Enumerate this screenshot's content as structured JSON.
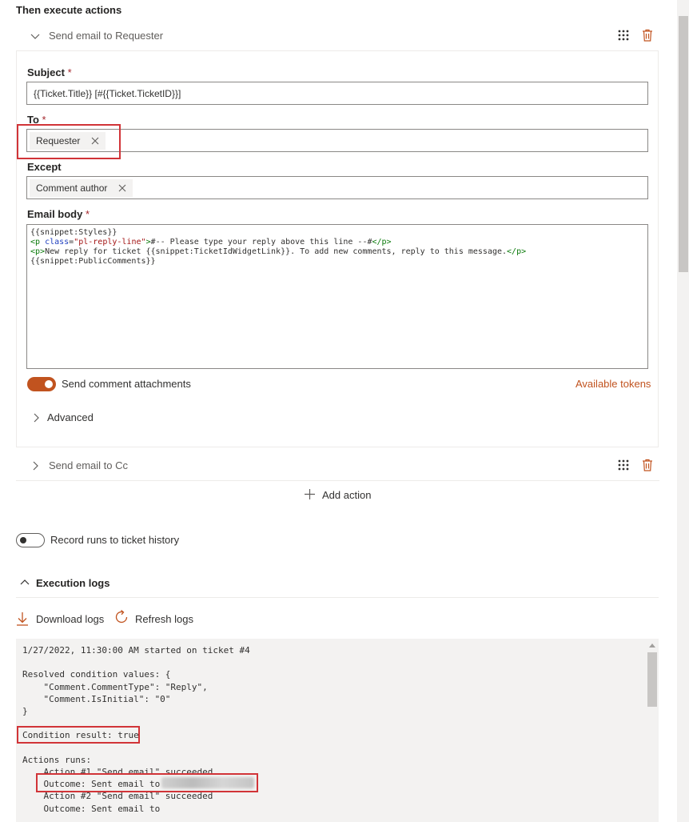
{
  "section_title": "Then execute actions",
  "actions": [
    {
      "label": "Send email to Requester",
      "expanded": true
    },
    {
      "label": "Send email to Cc",
      "expanded": false
    }
  ],
  "form": {
    "subject_label": "Subject",
    "subject_value": "{{Ticket.Title}} [#{{Ticket.TicketID}}]",
    "to_label": "To",
    "to_chip": "Requester",
    "except_label": "Except",
    "except_chip": "Comment author",
    "body_label": "Email body",
    "required_mark": "*",
    "body_lines": [
      {
        "parts": [
          {
            "t": "text",
            "v": "{{snippet:Styles}}"
          }
        ]
      },
      {
        "parts": [
          {
            "t": "tag",
            "v": "<p "
          },
          {
            "t": "aname",
            "v": "class"
          },
          {
            "t": "text",
            "v": "="
          },
          {
            "t": "attr",
            "v": "\"pl-reply-line\""
          },
          {
            "t": "tag",
            "v": ">"
          },
          {
            "t": "text",
            "v": "#-- Please type your reply above this line --#"
          },
          {
            "t": "tag",
            "v": "</p>"
          }
        ]
      },
      {
        "parts": [
          {
            "t": "tag",
            "v": "<p>"
          },
          {
            "t": "text",
            "v": "New reply for ticket {{snippet:TicketIdWidgetLink}}. To add new comments, reply to this message."
          },
          {
            "t": "tag",
            "v": "</p>"
          }
        ]
      },
      {
        "parts": [
          {
            "t": "text",
            "v": "{{snippet:PublicComments}}"
          }
        ]
      }
    ],
    "attachments_toggle_label": "Send comment attachments",
    "attachments_toggle_on": true,
    "available_tokens": "Available tokens",
    "advanced_label": "Advanced"
  },
  "add_action": "Add action",
  "record_runs_label": "Record runs to ticket history",
  "record_runs_on": false,
  "logs": {
    "title": "Execution logs",
    "download": "Download logs",
    "refresh": "Refresh logs",
    "lines": [
      "1/27/2022, 11:30:00 AM started on ticket #4",
      "",
      "Resolved condition values: {",
      "    \"Comment.CommentType\": \"Reply\",",
      "    \"Comment.IsInitial\": \"0\"",
      "}",
      "",
      "Condition result: true",
      "",
      "Actions runs:",
      "    Action #1 \"Send email\" succeeded",
      "    Outcome: Sent email to",
      "    Action #2 \"Send email\" succeeded",
      "    Outcome: Sent email to"
    ]
  },
  "colors": {
    "accent": "#c1531f",
    "highlight": "#d13438",
    "required": "#a4262c"
  }
}
